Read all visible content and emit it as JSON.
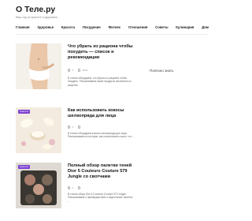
{
  "site": {
    "title": "О Теле.ру",
    "tagline": "Ваш гид по красоте и здоровью"
  },
  "nav": [
    "Главная",
    "Здоровье",
    "Красота",
    "Похудение",
    "Фитнес",
    "Отношения",
    "Советы",
    "Кулинария",
    "Дом"
  ],
  "sidebar": {
    "title": "Полезно знать"
  },
  "articles": [
    {
      "title": "Что убрать из рациона чтобы похудеть — список и рекомендации",
      "comments": "0",
      "views": "3520",
      "excerpt": "В статье обсуждаем, что убрать из рациона чтобы похудеть. Рассказываем какие продукты исключить из рациона."
    },
    {
      "title": "Как использовать кокосы шелкопряда для лица",
      "category": "Красота",
      "comments": "0",
      "views": "",
      "excerpt": "В статье обсуждаем коконы шелкопряда для лица. Рассказываем из истории, как использовать кокон, что …"
    },
    {
      "title": "Полный обзор палетки теней Dior 5 Couleurs Couture 579 Jungle со свотчами",
      "category": "Красота",
      "comments": "0",
      "views": "",
      "excerpt": "В статье обзор Dior 5 Couleurs Couture 579 Jungle. Рассказываем о преимуществах и недостатках палеток …"
    }
  ],
  "colors": {
    "badge": "#7b3fd1"
  }
}
